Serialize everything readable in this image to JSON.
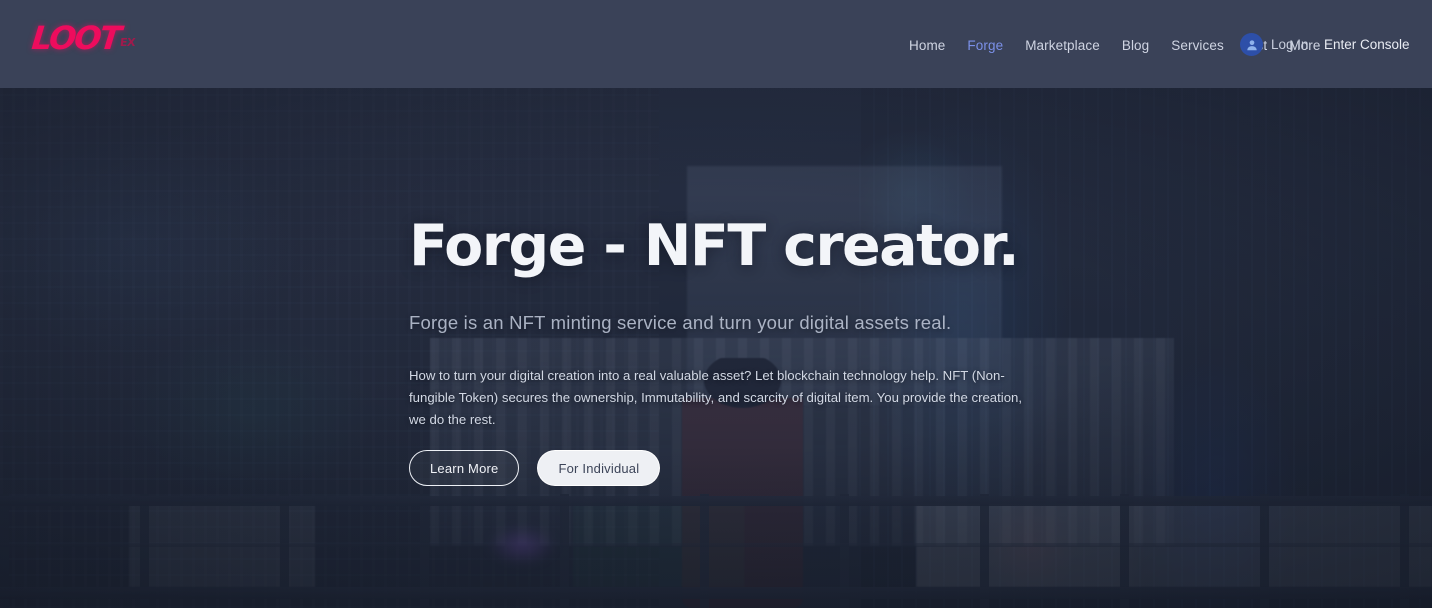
{
  "header": {
    "logo": {
      "word": "LOOT",
      "suffix": "EX"
    },
    "nav": [
      {
        "label": "Home",
        "active": false
      },
      {
        "label": "Forge",
        "active": true
      },
      {
        "label": "Marketplace",
        "active": false
      },
      {
        "label": "Blog",
        "active": false
      },
      {
        "label": "Services",
        "active": false
      },
      {
        "label": "List",
        "active": false
      },
      {
        "label": "More",
        "active": false
      }
    ],
    "account": {
      "icon": "user-avatar-icon",
      "label": "Log In"
    },
    "console_link": "Enter Console"
  },
  "hero": {
    "headline": "Forge - NFT creator.",
    "subheadline": "Forge is an NFT minting service and turn your digital assets real.",
    "paragraph": "How to turn your digital creation into a real valuable asset? Let blockchain technology help. NFT (Non-fungible Token) secures the ownership, Immutability, and scarcity of digital item. You provide the creation, we do the rest.",
    "buttons": [
      {
        "label": "Learn More",
        "style": "outline"
      },
      {
        "label": "For Individual",
        "style": "solid"
      }
    ]
  },
  "colors": {
    "header_bg": "#3a4258",
    "logo_pink": "#ee0c5d",
    "nav_active": "#7b90e8",
    "nav_text": "#cfd4e2",
    "avatar_blue": "#2d4fa8",
    "hero_text": "#f3f5f9",
    "btn_solid_bg": "#eef0f4"
  }
}
